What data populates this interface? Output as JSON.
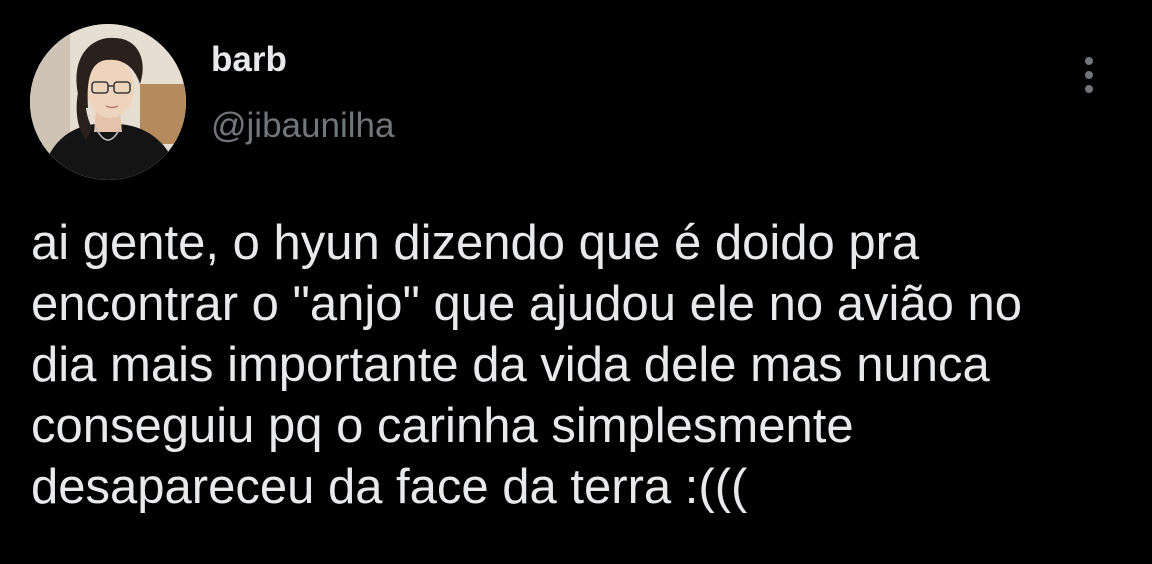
{
  "tweet": {
    "author": {
      "display_name": "barb",
      "handle": "@jibaunilha",
      "avatar_icon": "avatar-photo"
    },
    "more_icon": "more-vertical-icon",
    "text_lines": [
      "ai gente, o hyun dizendo que é doido pra",
      "encontrar o \"anjo\" que ajudou ele no avião no",
      "dia mais importante da vida dele mas nunca",
      "conseguiu pq o carinha simplesmente",
      "desapareceu da face da terra :((("
    ]
  },
  "colors": {
    "background": "#000000",
    "primary_text": "#e7e9ea",
    "secondary_text": "#71767b"
  }
}
